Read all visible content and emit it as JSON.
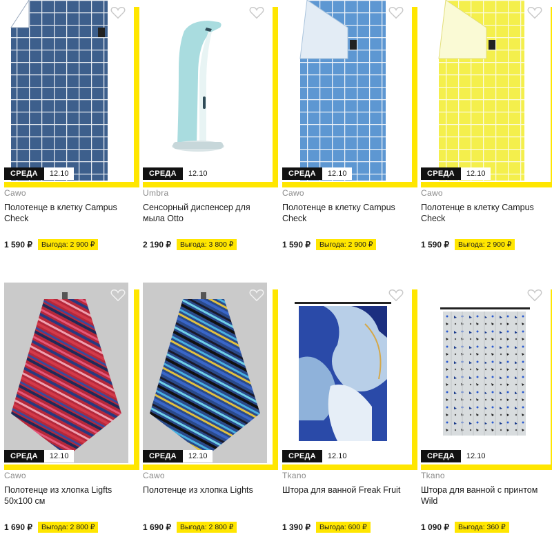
{
  "products": [
    {
      "brand": "Cawo",
      "title": "Полотенце в клетку Campus Check",
      "price": "1 590 ₽",
      "saving": "Выгода: 2 900 ₽",
      "badge_day": "СРЕДА",
      "badge_date": "12.10",
      "image": "towel-check-navy"
    },
    {
      "brand": "Umbra",
      "title": "Сенсорный диспенсер для мыла Otto",
      "price": "2 190 ₽",
      "saving": "Выгода: 3 800 ₽",
      "badge_day": "СРЕДА",
      "badge_date": "12.10",
      "image": "soap-dispenser-mint"
    },
    {
      "brand": "Cawo",
      "title": "Полотенце в клетку Campus Check",
      "price": "1 590 ₽",
      "saving": "Выгода: 2 900 ₽",
      "badge_day": "СРЕДА",
      "badge_date": "12.10",
      "image": "towel-check-blue"
    },
    {
      "brand": "Cawo",
      "title": "Полотенце в клетку Campus Check",
      "price": "1 590 ₽",
      "saving": "Выгода: 2 900 ₽",
      "badge_day": "СРЕДА",
      "badge_date": "12.10",
      "image": "towel-check-yellow"
    },
    {
      "brand": "Cawo",
      "title": "Полотенце из хлопка Ligfts 50x100 см",
      "price": "1 690 ₽",
      "saving": "Выгода: 2 800 ₽",
      "badge_day": "СРЕДА",
      "badge_date": "12.10",
      "image": "towel-stripes-red"
    },
    {
      "brand": "Cawo",
      "title": "Полотенце из хлопка Lights",
      "price": "1 690 ₽",
      "saving": "Выгода: 2 800 ₽",
      "badge_day": "СРЕДА",
      "badge_date": "12.10",
      "image": "towel-stripes-blue"
    },
    {
      "brand": "Tkano",
      "title": "Штора для ванной Freak Fruit",
      "price": "1 390 ₽",
      "saving": "Выгода: 600 ₽",
      "badge_day": "СРЕДА",
      "badge_date": "12.10",
      "image": "curtain-freak-fruit"
    },
    {
      "brand": "Tkano",
      "title": "Штора для ванной с принтом Wild",
      "price": "1 090 ₽",
      "saving": "Выгода: 360 ₽",
      "badge_day": "СРЕДА",
      "badge_date": "12.10",
      "image": "curtain-wild-print"
    }
  ],
  "colors": {
    "accent": "#ffe600",
    "badge_bg": "#111111",
    "brand_text": "#8a8a8a"
  },
  "icons": {
    "favorite": "heart-outline-icon"
  }
}
